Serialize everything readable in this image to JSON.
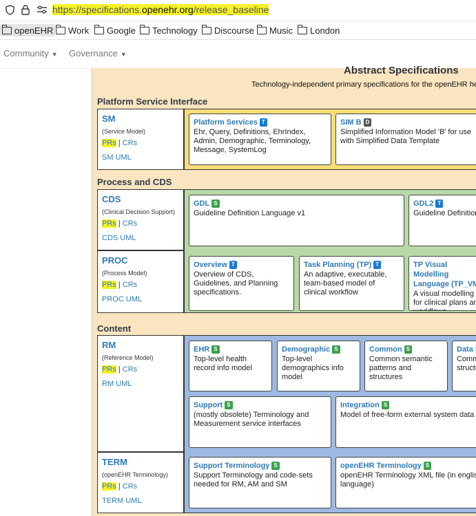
{
  "browser": {
    "url_prefix": "https://specifications.",
    "url_domain": "openehr.org",
    "url_path": "/release_baseline",
    "bookmarks": [
      "openEHR",
      "Work",
      "Google",
      "Technology",
      "Discourse",
      "Music",
      "London"
    ]
  },
  "site_nav": {
    "community": "Community",
    "governance": "Governance"
  },
  "abstract": {
    "title": "Abstract Specifications",
    "subtitle": "Technology-independent primary specifications for the openEHR hea"
  },
  "sections": {
    "psi": "Platform Service Interface",
    "proc_cds": "Process and CDS",
    "content": "Content"
  },
  "components": {
    "sm": {
      "code": "SM",
      "desc": "(Service Model)",
      "prs": "PRs",
      "sep": " | ",
      "crs": "CRs",
      "uml": "SM UML"
    },
    "cds": {
      "code": "CDS",
      "desc": "(Clinical Decision Support)",
      "prs": "PRs",
      "sep": " | ",
      "crs": "CRs",
      "uml": "CDS UML"
    },
    "proc": {
      "code": "PROC",
      "desc": "(Process Model)",
      "prs": "PRs",
      "sep": " | ",
      "crs": "CRs",
      "uml": "PROC UML"
    },
    "rm": {
      "code": "RM",
      "desc": "(Reference Model)",
      "prs": "PRs",
      "sep": " | ",
      "crs": "CRs",
      "uml": "RM UML"
    },
    "term": {
      "code": "TERM",
      "desc": "(openEHR Terminology)",
      "prs": "PRs",
      "sep": " | ",
      "crs": "CRs",
      "uml": "TERM UML"
    }
  },
  "cards": {
    "platform_services": {
      "title": "Platform Services",
      "badge": "T",
      "body": "Ehr, Query, Definitions, EhrIndex, Admin, Demographic, Terminology, Message, SystemLog"
    },
    "sim_b": {
      "title": "SIM B",
      "badge": "D",
      "body": "Simplified Information Model 'B' for use with Simplified Data Template"
    },
    "gdl": {
      "title": "GDL",
      "badge": "S",
      "body": "Guideline Definition Language v1"
    },
    "gdl2": {
      "title": "GDL2",
      "badge": "T",
      "body": "Guideline Definition"
    },
    "overview": {
      "title": "Overview",
      "badge": "T",
      "body": "Overview of CDS, Guidelines, and Planning specifications."
    },
    "task_planning": {
      "title": "Task Planning (TP)",
      "badge": "T",
      "body": "An adaptive, executable, team-based model of clinical workflow"
    },
    "tp_vml": {
      "title": "TP Visual Modelling Language (TP_VM",
      "badge": "",
      "body": "A visual modelling l for clinical plans an workflows."
    },
    "ehr": {
      "title": "EHR",
      "badge": "S",
      "body": "Top-level health record info model"
    },
    "demographic": {
      "title": "Demographic",
      "badge": "S",
      "body": "Top-level demographics info model"
    },
    "common": {
      "title": "Common",
      "badge": "S",
      "body": "Common semantic patterns and structures"
    },
    "data_s": {
      "title": "Data S",
      "badge": "",
      "body": "Comm structu"
    },
    "support": {
      "title": "Support",
      "badge": "S",
      "body": "(mostly obsolete) Terminology and Measurement service interfaces"
    },
    "integration": {
      "title": "Integration",
      "badge": "S",
      "body": "Model of free-form external system data"
    },
    "support_terminology": {
      "title": "Support Terminology",
      "badge": "S",
      "body": "Support Terminology and code-sets needed for RM, AM and SM"
    },
    "openehr_terminology": {
      "title": "openEHR Terminology",
      "badge": "S",
      "body": "openEHR Terminology XML file (in english language)"
    }
  },
  "colors": {
    "page_bg": "#fbe5c0",
    "psi_band": "#f8dd78",
    "proc_band": "#b7d9a6",
    "content_band": "#9eb9e2",
    "link": "#2e7bb6",
    "highlight": "#f5f127",
    "badge_T": "#1a78d2",
    "badge_S": "#3aa04a",
    "badge_D": "#555555"
  }
}
